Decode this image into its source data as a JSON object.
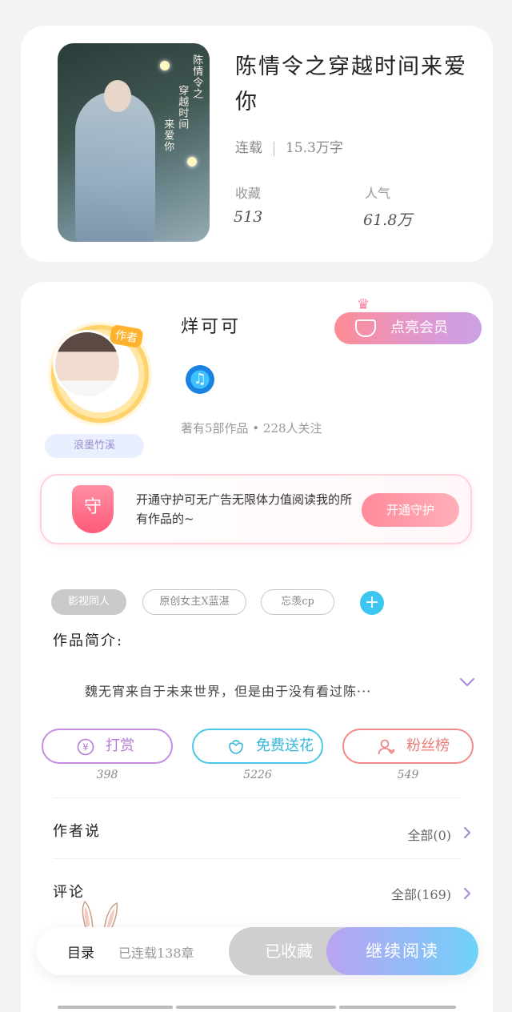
{
  "book": {
    "title": "陈情令之穿越时间来爱你",
    "status": "连载",
    "word_count": "15.3万字",
    "cover_text_1": "陈情令之",
    "cover_text_2": "穿越时间",
    "cover_text_3": "来爱你",
    "stats": [
      {
        "label": "收藏",
        "value": "513"
      },
      {
        "label": "人气",
        "value": "61.8万"
      }
    ]
  },
  "author": {
    "name": "烊可可",
    "tag": "作者",
    "badge": "浪墨竹溪",
    "stats_text": "著有5部作品 • 228人关注",
    "vip_button": "点亮会员"
  },
  "guard": {
    "shield_char": "守",
    "text": "开通守护可无广告无限体力值阅读我的所有作品的~",
    "button": "开通守护"
  },
  "tags": [
    "影视同人",
    "原创女主X蓝湛",
    "忘羡cp"
  ],
  "intro": {
    "label": "作品简介:",
    "text": "魏无宵来自于未来世界，但是由于没有看过陈···"
  },
  "actions": [
    {
      "label": "打赏",
      "count": "398",
      "icon": "yen-icon",
      "color": "#c58be0"
    },
    {
      "label": "免费送花",
      "count": "5226",
      "icon": "flower-icon",
      "color": "#49c7e6"
    },
    {
      "label": "粉丝榜",
      "count": "549",
      "icon": "fan-icon",
      "color": "#f28a8a"
    }
  ],
  "author_says": {
    "label": "作者说",
    "link": "全部(0)"
  },
  "comments": {
    "label": "评论",
    "link": "全部(169)"
  },
  "bottom_bar": {
    "toc_label": "目录",
    "toc_status": "已连载138章",
    "saved_button": "已收藏",
    "read_button": "继续阅读"
  }
}
